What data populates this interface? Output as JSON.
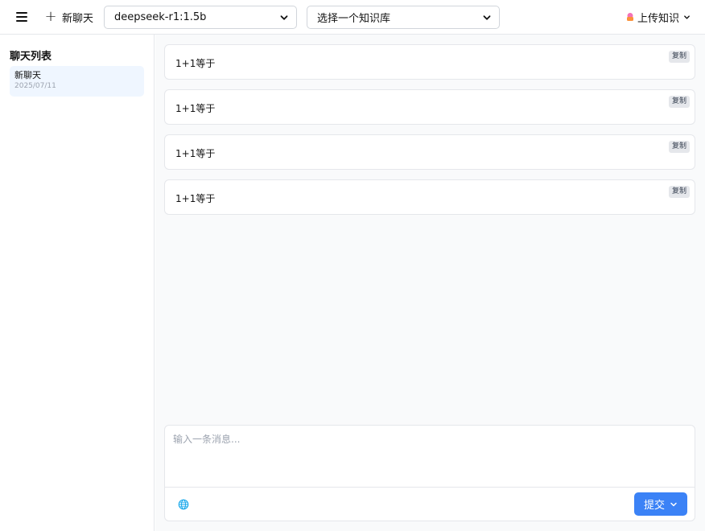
{
  "topbar": {
    "new_chat_label": "新聊天",
    "model_select_value": "deepseek-r1:1.5b",
    "kb_select_value": "选择一个知识库",
    "upload_label": "上传知识"
  },
  "sidebar": {
    "title": "聊天列表",
    "chats": [
      {
        "title": "新聊天",
        "date": "2025/07/11"
      }
    ]
  },
  "messages": [
    {
      "text": "1+1等于",
      "copy_label": "复制"
    },
    {
      "text": "1+1等于",
      "copy_label": "复制"
    },
    {
      "text": "1+1等于",
      "copy_label": "复制"
    },
    {
      "text": "1+1等于",
      "copy_label": "复制"
    }
  ],
  "composer": {
    "placeholder": "输入一条消息...",
    "submit_label": "提交"
  },
  "colors": {
    "accent": "#3b82f6",
    "active_chat_bg": "#eff6ff",
    "main_bg": "#f9fafb"
  },
  "icons": {
    "menu": "menu-icon",
    "plus": "plus-icon",
    "chevron": "chevron-down-icon",
    "upload": "upload-icon",
    "globe": "globe-icon"
  }
}
